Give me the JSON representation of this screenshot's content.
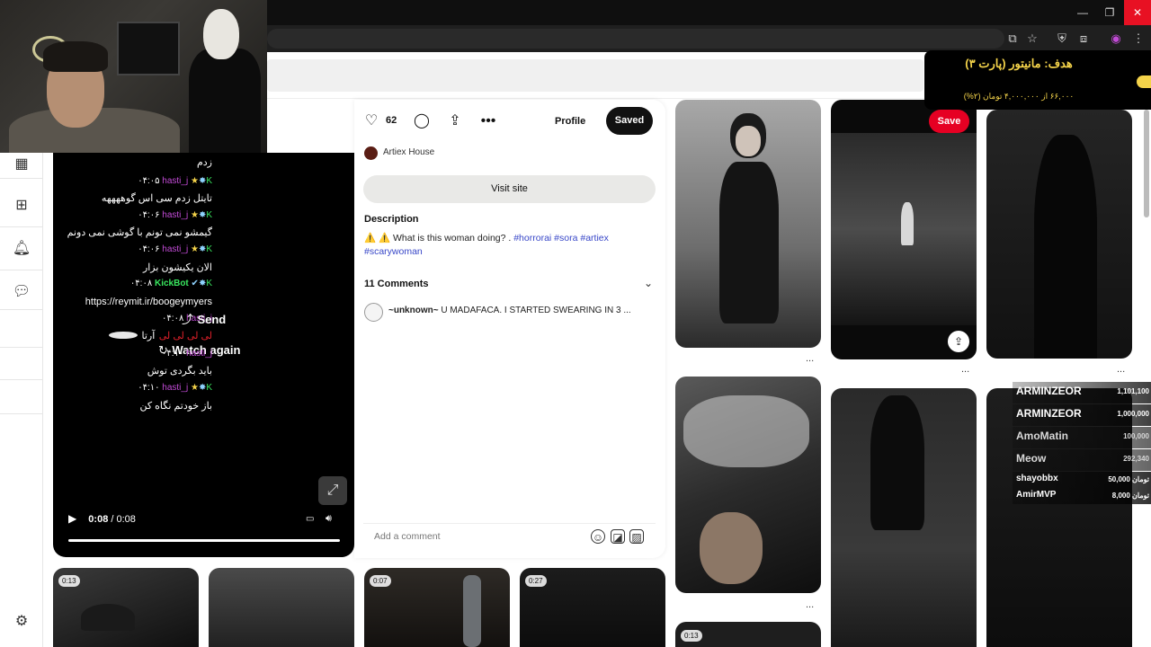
{
  "video": {
    "time_current": "0:08",
    "time_total": "/ 0:08",
    "send_label": "Send",
    "watch_again_label": "Watch again",
    "top_fragment": "زدم",
    "chat": [
      {
        "time": "۰۴:۰۵",
        "user": "hasti_j",
        "message": "تایتل زدم سی اس گوههههه"
      },
      {
        "time": "۰۴:۰۶",
        "user": "hasti_j",
        "message": "گیمشو نمی تونم با گوشی نمی دونم"
      },
      {
        "time": "۰۴:۰۶",
        "user": "hasti_j",
        "message": "الان یکیشون بزار"
      },
      {
        "time": "۰۴:۰۸",
        "user": "KickBot",
        "message": "https://reymit.ir/boogeymyers"
      },
      {
        "time": "۰۴:۰۸",
        "user": "hasti_j",
        "message": "آرتا"
      },
      {
        "time": "۰۴:۱۰",
        "user": "hasti_j",
        "message": "باید بگردی توش"
      },
      {
        "time": "۰۴:۱۰",
        "user": "hasti_j",
        "message": "باز خودتم نگاه کن"
      }
    ],
    "red_text": "لی لی لی لی"
  },
  "pin": {
    "likes": "62",
    "profile_label": "Profile",
    "saved_label": "Saved",
    "author": "Artiex House",
    "visit_label": "Visit site",
    "description_heading": "Description",
    "description_text": "⚠️ ⚠️ What is this woman doing? .",
    "tags": [
      "#horrorai",
      "#sora",
      "#artiex",
      "#scarywoman"
    ],
    "comments_heading": "11 Comments",
    "comment_user": "~unknown~",
    "comment_text": "U MADAFACA. I STARTED SWEARING IN 3 ...",
    "add_comment_placeholder": "Add a comment"
  },
  "grid": {
    "save_label": "Save",
    "badges": [
      "0:13",
      "0:07",
      "0:27",
      "0:13"
    ],
    "more": "..."
  },
  "goal": {
    "title": "هدف: مانیتور (پارت ۳)",
    "subtitle": "۶۶,۰۰۰ از ۴,۰۰۰,۰۰۰ تومان (۲%)"
  },
  "leaderboard": [
    {
      "name": "ARMINZEOR",
      "value": "1,101,100",
      "color": "#ffffff"
    },
    {
      "name": "ARMINZEOR",
      "value": "1,000,000",
      "color": "#ffffff"
    },
    {
      "name": "AmoMatin",
      "value": "100,000",
      "color": "#cfcfcf"
    },
    {
      "name": "Meow",
      "value": "292,340",
      "color": "#cfcfcf"
    },
    {
      "name": "shayobbx",
      "value": "50,000 تومان",
      "color": "#ffffff"
    },
    {
      "name": "AmirMVP",
      "value": "8,000 تومان",
      "color": "#ffffff"
    }
  ],
  "colors": {
    "pinterest_red": "#e60023",
    "chat_user": "#c24bd6",
    "bot_green": "#39e75f",
    "goal_yellow": "#f4d34a"
  }
}
